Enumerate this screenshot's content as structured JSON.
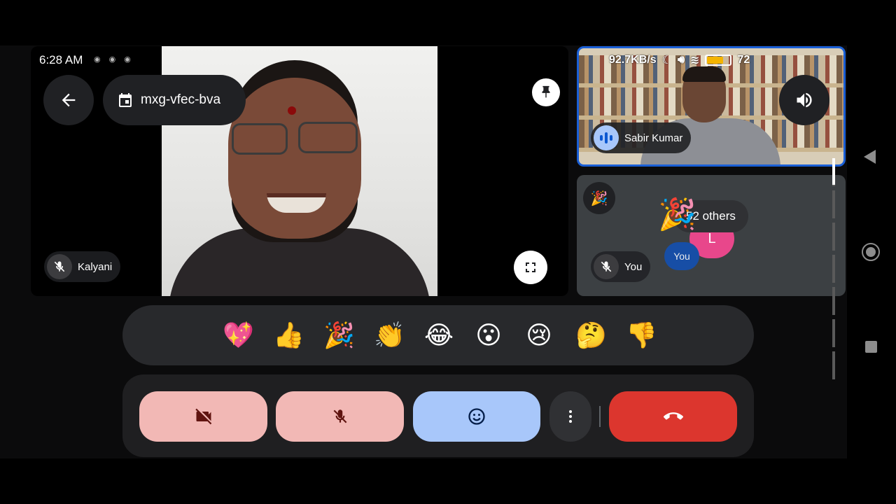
{
  "status": {
    "time": "6:28 AM",
    "network_speed": "92.7KB/s",
    "battery": "72",
    "battery_level": 0.72
  },
  "meeting": {
    "code": "mxg-vfec-bva"
  },
  "participants": {
    "main": {
      "name": "Kalyani"
    },
    "speaker": {
      "name": "Sabir Kumar"
    },
    "self": {
      "name": "You",
      "avatar_label": "You"
    },
    "others": {
      "label": "52 others",
      "avatar_letter": "L"
    }
  },
  "reactions": [
    "💖",
    "👍",
    "🎉",
    "👏",
    "😂",
    "😮",
    "😢",
    "🤔",
    "👎"
  ],
  "icons": {
    "back": "arrow-left-icon",
    "calendar": "calendar-icon",
    "pin": "pin-icon",
    "fullscreen": "fullscreen-icon",
    "volume": "volume-icon",
    "camera_off": "camera-off-icon",
    "mic_off": "mic-off-icon",
    "emoji": "emoji-icon",
    "more": "more-vert-icon",
    "end_call": "end-call-icon"
  },
  "colors": {
    "accent_blue": "#a8c7fa",
    "muted_pink": "#f2b8b5",
    "end_red": "#dc362e",
    "active_border": "#1a5fd6"
  }
}
